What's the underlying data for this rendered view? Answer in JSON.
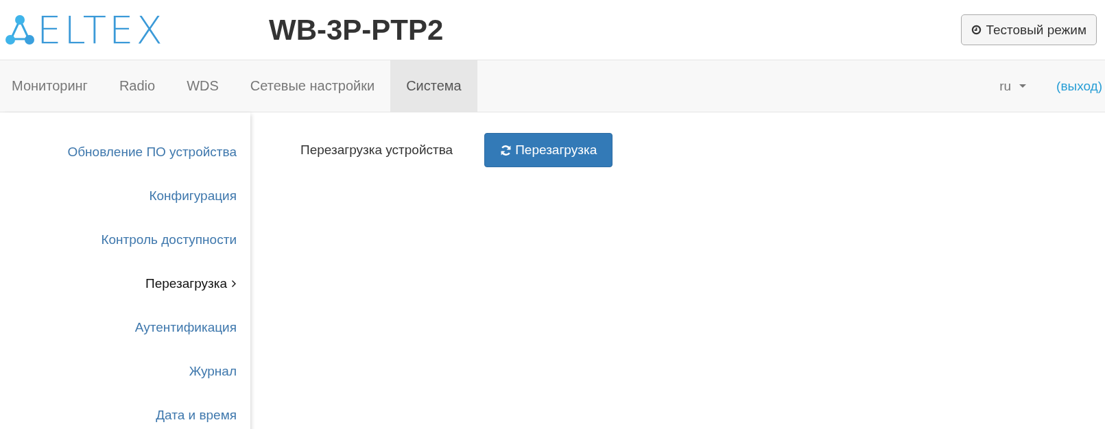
{
  "logo": {
    "text": "ELTEX"
  },
  "device_title": "WB-3P-PTP2",
  "test_mode_button": {
    "label": "Тестовый режим"
  },
  "nav": {
    "tabs": [
      {
        "label": "Мониторинг",
        "selected": false
      },
      {
        "label": "Radio",
        "selected": false
      },
      {
        "label": "WDS",
        "selected": false
      },
      {
        "label": "Сетевые настройки",
        "selected": false
      },
      {
        "label": "Система",
        "selected": true
      }
    ],
    "language": "ru",
    "logout": "(выход)"
  },
  "sidebar": {
    "items": [
      {
        "label": "Обновление ПО устройства",
        "selected": false
      },
      {
        "label": "Конфигурация",
        "selected": false
      },
      {
        "label": "Контроль доступности",
        "selected": false
      },
      {
        "label": "Перезагрузка",
        "selected": true
      },
      {
        "label": "Аутентификация",
        "selected": false
      },
      {
        "label": "Журнал",
        "selected": false
      },
      {
        "label": "Дата и время",
        "selected": false
      }
    ]
  },
  "content": {
    "label": "Перезагрузка устройства",
    "button": "Перезагрузка"
  }
}
